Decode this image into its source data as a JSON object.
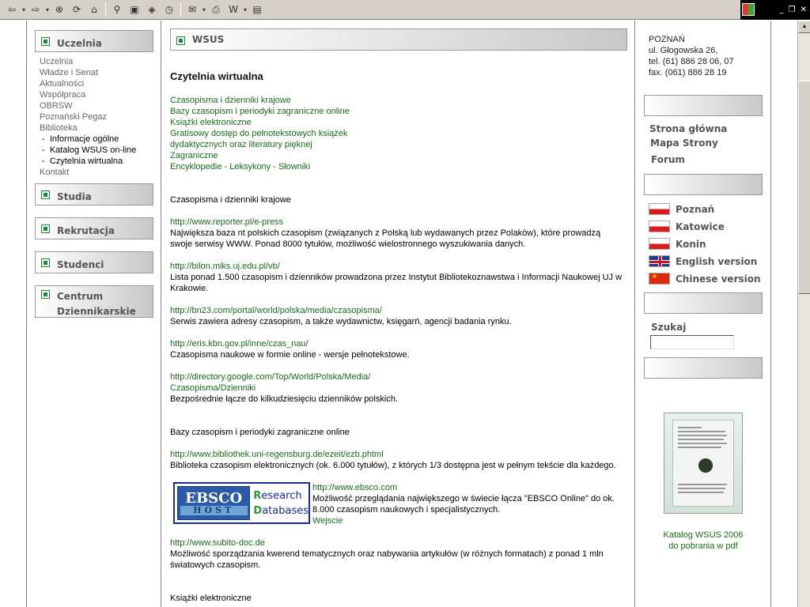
{
  "toolbar": {
    "icons": [
      "back-icon",
      "forward-icon",
      "stop-icon",
      "refresh-icon",
      "home-icon",
      "search-icon",
      "favorites-icon",
      "media-icon",
      "history-icon",
      "edit-icon",
      "print-icon",
      "word-icon",
      "discuss-icon"
    ]
  },
  "left_nav": {
    "uczelnia_title": "Uczelnia",
    "items": [
      "Uczelnia",
      "Władze i Senat",
      "Aktualności",
      "Współpraca",
      "OBRSW",
      "Poznański Pegaz",
      "Biblioteka"
    ],
    "sub_items": [
      " -  Informacje ogólne",
      " -  Katalog WSUS on-line",
      " -  Czytelnia wirtualna"
    ],
    "last_item": "Kontakt",
    "studia": "Studia",
    "rekrutacja": "Rekrutacja",
    "studenci": "Studenci",
    "centrum_line1": "Centrum",
    "centrum_line2": "Dziennikarskie"
  },
  "main": {
    "header": "WSUS",
    "title": "Czytelnia wirtualna",
    "toc": [
      "Czasopisma i dzienniki krajowe",
      "Bazy czasopism i periodyki zagraniczne online",
      "Książki elektroniczne",
      "Gratisowy dostęp do pełnotekstowych książek",
      "dydaktycznych oraz literatury pięknej",
      "Zagraniczne",
      "Encyklopedie - Leksykony - Słowniki"
    ],
    "sec1_title": "Czasopisma i dzienniki krajowe",
    "entries1": [
      {
        "url": "http://www.reporter.pl/e-press",
        "desc1": "Największa baza nt polskich czasopism (związanych z Polską lub wydawanych przez Polaków), które prowadzą",
        "desc2": "swoje serwisy WWW. Ponad 8000 tytułów, możliwość wielostronnego wyszukiwania danych."
      },
      {
        "url": "http://bilon.miks.uj.edu.pl/vb/",
        "desc1": "Lista ponad 1.500 czasopism i dzienników prowadzona przez Instytut Bibliotekoznawstwa i Informacji Naukowej UJ w",
        "desc2": "Krakowie."
      },
      {
        "url": "http://bn23.com/portal/world/polska/media/czasopisma/",
        "desc1": "Serwis zawiera adresy czasopism, a także wydawnictw, księgarń, agencji badania rynku.",
        "desc2": ""
      },
      {
        "url": "http://eris.kbn.gov.pl/inne/czas_nau/",
        "desc1": "Czasopisma naukowe w formie online - wersje pełnotekstowe.",
        "desc2": ""
      }
    ],
    "google_url1": "http://directory.google.com/Top/World/Polska/Media/",
    "google_url2": "Czasopisma/Dzienniki",
    "google_desc": "Bezpośrednie łącze do kilkudziesięciu dzienników polskich.",
    "sec2_title": "Bazy czasopism i periodyki zagraniczne online",
    "regensburg_url": "http://www.bibliothek.uni-regensburg.de/ezeit/ezb.phtml",
    "regensburg_desc": "Biblioteka czasopism elektronicznych (ok. 6.000 tytułów), z których 1/3 dostępna jest w pełnym tekście dla każdego.",
    "ebsco": {
      "logo_top": "EBSCO",
      "logo_bottom": "HOST",
      "rd1": "R",
      "rd1b": "esearch",
      "rd2": "D",
      "rd2b": "atabases",
      "url": "http://www.ebsco.com",
      "desc1": "Możliwość przeglądania największego w świecie łącza \"EBSCO Online\" do ok.",
      "desc2": "8.000 czasopism naukowych i specjalistycznych.",
      "enter": "Wejscie"
    },
    "subito_url": "http://www.subito-doc.de",
    "subito_desc1": "Możliwość sporządzania kwerend tematycznych oraz nabywania artykułów (w różnych formatach) z ponad 1 mln",
    "subito_desc2": "światowych czasopism.",
    "sec3_title": "Książki elektroniczne"
  },
  "right": {
    "address": [
      "POZNAŃ",
      "ul. Głogowska 26,",
      "tel. (61) 886 28 06, 07",
      "fax. (061) 886 28 19"
    ],
    "links": [
      "Strona główna",
      "Mapa Strony",
      "Forum"
    ],
    "langs": [
      {
        "label": "Poznań",
        "flag": "pl"
      },
      {
        "label": "Katowice",
        "flag": "pl"
      },
      {
        "label": "Konin",
        "flag": "pl"
      },
      {
        "label": "English version",
        "flag": "uk"
      },
      {
        "label": "Chinese version",
        "flag": "cn"
      }
    ],
    "search_label": "Szukaj",
    "catalog_line1": "Katalog WSUS 2006",
    "catalog_line2": "do pobrania w pdf"
  }
}
